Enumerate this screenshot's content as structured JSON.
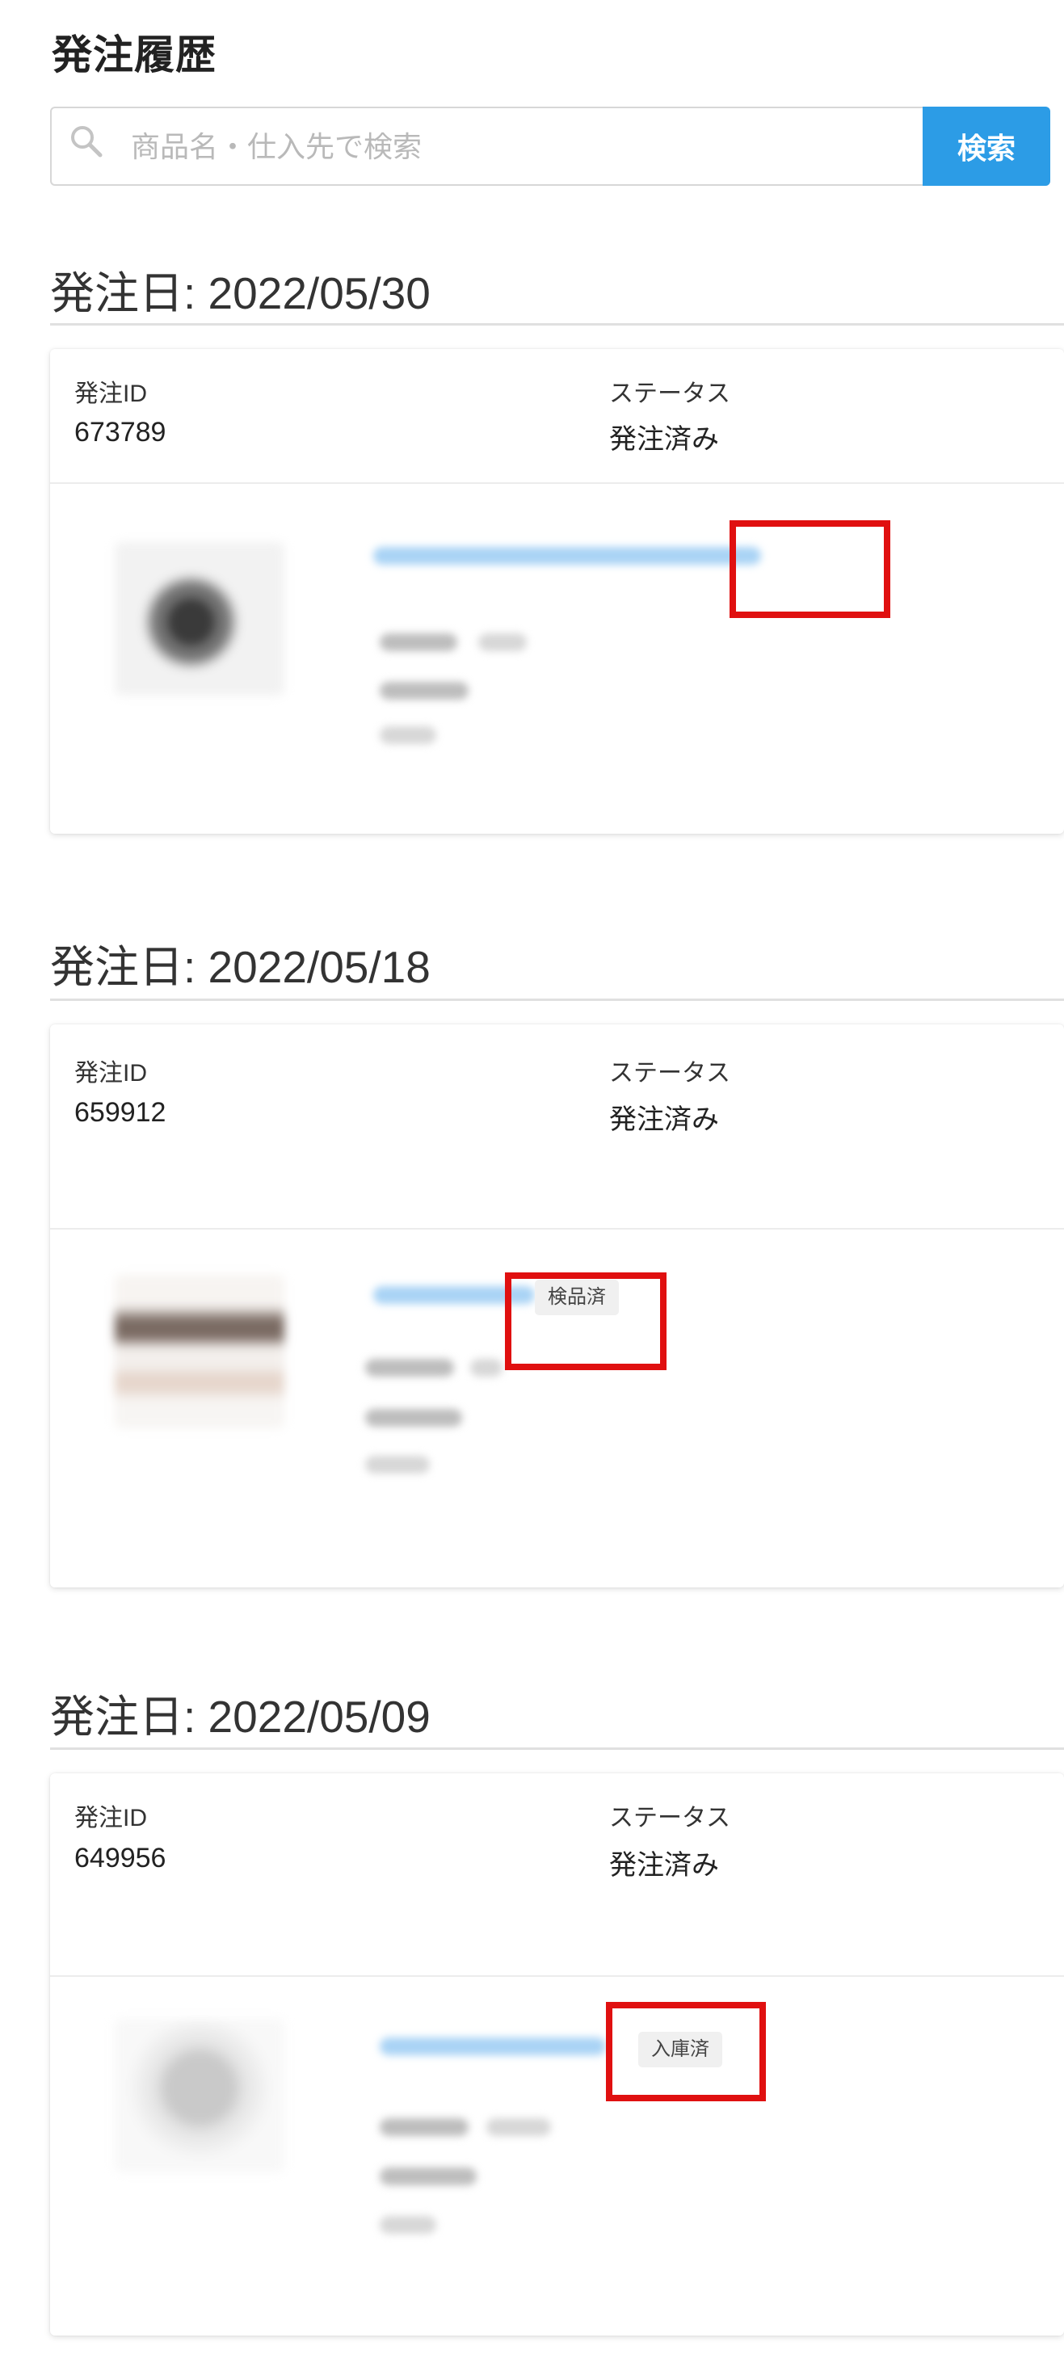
{
  "page": {
    "title": "発注履歴"
  },
  "search": {
    "placeholder": "商品名・仕入先で検索",
    "button_label": "検索"
  },
  "labels": {
    "order_id": "発注ID",
    "status": "ステータス"
  },
  "orders": [
    {
      "date_heading": "発注日: 2022/05/30",
      "order_id": "673789",
      "status": "発注済み",
      "item_badge": ""
    },
    {
      "date_heading": "発注日: 2022/05/18",
      "order_id": "659912",
      "status": "発注済み",
      "item_badge": "検品済"
    },
    {
      "date_heading": "発注日: 2022/05/09",
      "order_id": "649956",
      "status": "発注済み",
      "item_badge": "入庫済"
    }
  ],
  "colors": {
    "accent": "#2c9ce6",
    "annotation": "#e01010",
    "badge_bg": "#f0f0f0"
  },
  "icons": {
    "search": "search-icon"
  }
}
